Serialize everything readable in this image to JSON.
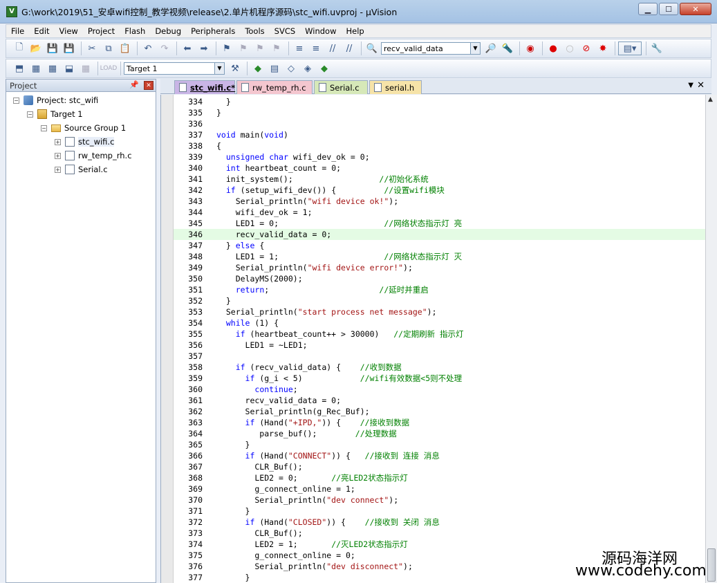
{
  "window": {
    "title": "G:\\work\\2019\\51_安卓wifi控制_教学视频\\release\\2.单片机程序源码\\stc_wifi.uvproj - µVision",
    "app_icon": "V"
  },
  "menu": [
    "File",
    "Edit",
    "View",
    "Project",
    "Flash",
    "Debug",
    "Peripherals",
    "Tools",
    "SVCS",
    "Window",
    "Help"
  ],
  "toolbar": {
    "find_value": "recv_valid_data",
    "target_value": "Target 1"
  },
  "project": {
    "header": "Project",
    "root": "Project: stc_wifi",
    "target": "Target 1",
    "group": "Source Group 1",
    "files": [
      "stc_wifi.c",
      "rw_temp_rh.c",
      "Serial.c"
    ]
  },
  "tabs": [
    {
      "label": "stc_wifi.c*",
      "color": "#c9b5e6"
    },
    {
      "label": "rw_temp_rh.c",
      "color": "#f4c6cf"
    },
    {
      "label": "Serial.c",
      "color": "#d6e8b8"
    },
    {
      "label": "serial.h",
      "color": "#f6e3a8"
    }
  ],
  "code": [
    {
      "n": "334",
      "t": "  }",
      "hl": false
    },
    {
      "n": "335",
      "t": "}",
      "hl": false
    },
    {
      "n": "336",
      "t": "",
      "hl": false
    },
    {
      "n": "337",
      "t": "void main(void)",
      "hl": false
    },
    {
      "n": "338",
      "t": "{",
      "hl": false
    },
    {
      "n": "339",
      "t": "  unsigned char wifi_dev_ok = 0;",
      "hl": false
    },
    {
      "n": "340",
      "t": "  int heartbeat_count = 0;",
      "hl": false
    },
    {
      "n": "341",
      "t": "  init_system();                  //初始化系统",
      "hl": false
    },
    {
      "n": "342",
      "t": "  if (setup_wifi_dev()) {          //设置wifi模块",
      "hl": false
    },
    {
      "n": "343",
      "t": "    Serial_println(\"wifi device ok!\");",
      "hl": false
    },
    {
      "n": "344",
      "t": "    wifi_dev_ok = 1;",
      "hl": false
    },
    {
      "n": "345",
      "t": "    LED1 = 0;                      //网络状态指示灯 亮",
      "hl": false
    },
    {
      "n": "346",
      "t": "    recv_valid_data = 0;",
      "hl": true
    },
    {
      "n": "347",
      "t": "  } else {",
      "hl": false
    },
    {
      "n": "348",
      "t": "    LED1 = 1;                      //网络状态指示灯 灭",
      "hl": false
    },
    {
      "n": "349",
      "t": "    Serial_println(\"wifi device error!\");",
      "hl": false
    },
    {
      "n": "350",
      "t": "    DelayMS(2000);",
      "hl": false
    },
    {
      "n": "351",
      "t": "    return;                       //延时并重启",
      "hl": false
    },
    {
      "n": "352",
      "t": "  }",
      "hl": false
    },
    {
      "n": "353",
      "t": "  Serial_println(\"start process net message\");",
      "hl": false
    },
    {
      "n": "354",
      "t": "  while (1) {",
      "hl": false
    },
    {
      "n": "355",
      "t": "    if (heartbeat_count++ > 30000)   //定期刷新 指示灯",
      "hl": false
    },
    {
      "n": "356",
      "t": "      LED1 = ~LED1;",
      "hl": false
    },
    {
      "n": "357",
      "t": "",
      "hl": false
    },
    {
      "n": "358",
      "t": "    if (recv_valid_data) {    //收到数据",
      "hl": false
    },
    {
      "n": "359",
      "t": "      if (g_i < 5)            //wifi有效数据<5则不处理",
      "hl": false
    },
    {
      "n": "360",
      "t": "        continue;",
      "hl": false
    },
    {
      "n": "361",
      "t": "      recv_valid_data = 0;",
      "hl": false
    },
    {
      "n": "362",
      "t": "      Serial_println(g_Rec_Buf);",
      "hl": false
    },
    {
      "n": "363",
      "t": "      if (Hand(\"+IPD,\")) {    //接收到数据",
      "hl": false
    },
    {
      "n": "364",
      "t": "         parse_buf();        //处理数据",
      "hl": false
    },
    {
      "n": "365",
      "t": "      }",
      "hl": false
    },
    {
      "n": "366",
      "t": "      if (Hand(\"CONNECT\")) {   //接收到 连接 消息",
      "hl": false
    },
    {
      "n": "367",
      "t": "        CLR_Buf();",
      "hl": false
    },
    {
      "n": "368",
      "t": "        LED2 = 0;       //亮LED2状态指示灯",
      "hl": false
    },
    {
      "n": "369",
      "t": "        g_connect_online = 1;",
      "hl": false
    },
    {
      "n": "370",
      "t": "        Serial_println(\"dev connect\");",
      "hl": false
    },
    {
      "n": "371",
      "t": "      }",
      "hl": false
    },
    {
      "n": "372",
      "t": "      if (Hand(\"CLOSED\")) {    //接收到 关闭 消息",
      "hl": false
    },
    {
      "n": "373",
      "t": "        CLR_Buf();",
      "hl": false
    },
    {
      "n": "374",
      "t": "        LED2 = 1;       //灭LED2状态指示灯",
      "hl": false
    },
    {
      "n": "375",
      "t": "        g_connect_online = 0;",
      "hl": false
    },
    {
      "n": "376",
      "t": "        Serial_println(\"dev disconnect\");",
      "hl": false
    },
    {
      "n": "377",
      "t": "      }",
      "hl": false
    }
  ],
  "watermark": {
    "line1": "源码海洋网",
    "line2": "www.codehy.com"
  }
}
